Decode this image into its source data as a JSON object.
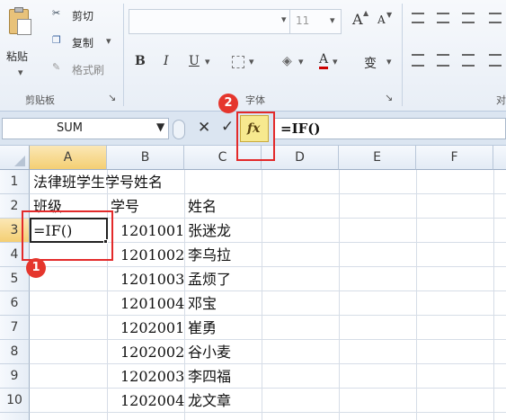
{
  "ribbon": {
    "clipboard": {
      "paste_label": "粘贴",
      "cut_label": "剪切",
      "copy_label": "复制",
      "format_painter_label": "格式刷",
      "group_label": "剪贴板"
    },
    "font": {
      "size_value": "11",
      "group_label": "字体",
      "bold": "B",
      "italic": "I",
      "underline": "U",
      "grow": "A",
      "shrink": "A",
      "font_color": "A",
      "phonetic": "变"
    },
    "alignment": {
      "group_label_partial": "对"
    }
  },
  "formula_bar": {
    "name_box": "SUM",
    "cancel_symbol": "✕",
    "enter_symbol": "✓",
    "fx_symbol": "fx",
    "formula": "=IF()"
  },
  "grid": {
    "columns": [
      "A",
      "B",
      "C",
      "D",
      "E",
      "F"
    ],
    "rows": [
      "1",
      "2",
      "3",
      "4",
      "5",
      "6",
      "7",
      "8",
      "9",
      "10"
    ],
    "cells": {
      "A1": "法律班学生学号姓名",
      "A2": "班级",
      "B2": "学号",
      "C2": "姓名",
      "A3": "=IF()",
      "B3": "1201001",
      "C3": "张迷龙",
      "B4": "1201002",
      "C4": "李乌拉",
      "B5": "1201003",
      "C5": "孟烦了",
      "B6": "1201004",
      "C6": "邓宝",
      "B7": "1202001",
      "C7": "崔勇",
      "B8": "1202002",
      "C8": "谷小麦",
      "B9": "1202003",
      "C9": "李四福",
      "B10": "1202004",
      "C10": "龙文章"
    }
  },
  "annotations": {
    "badge1": "1",
    "badge2": "2",
    "color": "#e32a2a"
  }
}
